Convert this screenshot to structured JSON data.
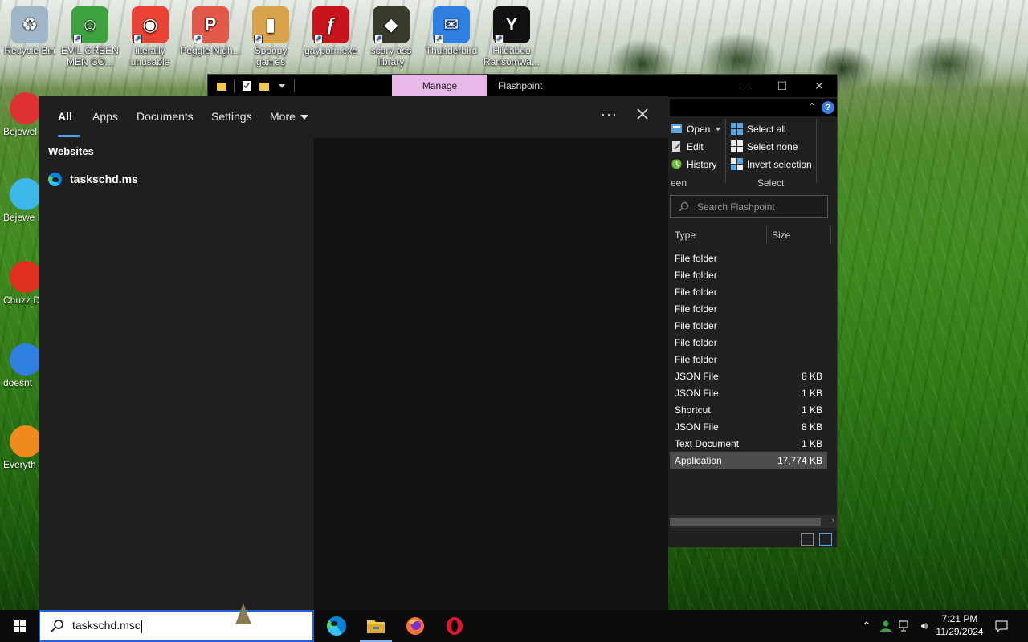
{
  "desktop": {
    "top_icons": [
      {
        "label": "Recycle Bin",
        "color": "#9fb6c8",
        "glyph": "♻"
      },
      {
        "label": "EVIL GREEN MEN CO...",
        "color": "#3ea33e",
        "glyph": "☺"
      },
      {
        "label": "literally unusable",
        "color": "#ea4335",
        "glyph": "◉"
      },
      {
        "label": "Peggle Nigh...",
        "color": "#e2584a",
        "glyph": "P"
      },
      {
        "label": "Spoopy games",
        "color": "#d8a24a",
        "glyph": "▮"
      },
      {
        "label": "gayporn.exe",
        "color": "#c8151b",
        "glyph": "ƒ"
      },
      {
        "label": "scary ass library",
        "color": "#3a3a2a",
        "glyph": "◆"
      },
      {
        "label": "Thunderbird",
        "color": "#2f7fe0",
        "glyph": "✉"
      },
      {
        "label": "Hildaboo Ransomwa...",
        "color": "#111111",
        "glyph": "Y"
      }
    ],
    "left_icons": [
      {
        "label": "Bejewel Delux",
        "color": "#d33"
      },
      {
        "label": "Bejewe Delux",
        "color": "#3bb7e8"
      },
      {
        "label": "Chuzz Delux",
        "color": "#e03020"
      },
      {
        "label": "doesnt",
        "color": "#2f7fe0"
      },
      {
        "label": "Everyth",
        "color": "#f08a1c"
      }
    ]
  },
  "explorer": {
    "manage_tab": "Manage",
    "title": "Flashpoint",
    "ribbon": {
      "open": "Open",
      "edit": "Edit",
      "history": "History",
      "open_group": "een",
      "select_all": "Select all",
      "select_none": "Select none",
      "invert_selection": "Invert selection",
      "select_group": "Select"
    },
    "search_placeholder": "Search Flashpoint",
    "columns": {
      "type": "Type",
      "size": "Size"
    },
    "rows": [
      {
        "type": "File folder",
        "size": ""
      },
      {
        "type": "File folder",
        "size": ""
      },
      {
        "type": "File folder",
        "size": ""
      },
      {
        "type": "File folder",
        "size": ""
      },
      {
        "type": "File folder",
        "size": ""
      },
      {
        "type": "File folder",
        "size": ""
      },
      {
        "type": "File folder",
        "size": ""
      },
      {
        "type": "JSON File",
        "size": "8 KB"
      },
      {
        "type": "JSON File",
        "size": "1 KB"
      },
      {
        "type": "Shortcut",
        "size": "1 KB"
      },
      {
        "type": "JSON File",
        "size": "8 KB"
      },
      {
        "type": "Text Document",
        "size": "1 KB"
      },
      {
        "type": "Application",
        "size": "17,774 KB"
      }
    ],
    "selected_row": 12
  },
  "search_panel": {
    "tabs": [
      "All",
      "Apps",
      "Documents",
      "Settings",
      "More"
    ],
    "active_tab": "All",
    "group_title": "Websites",
    "results": [
      {
        "label": "taskschd.ms",
        "icon": "edge-icon"
      }
    ]
  },
  "taskbar": {
    "search_value": "taskschd.msc",
    "apps": [
      "edge-icon",
      "file-explorer-icon",
      "firefox-icon",
      "opera-icon"
    ],
    "active_app": "file-explorer-icon",
    "time": "7:21 PM",
    "date": "11/29/2024"
  },
  "colors": {
    "accent": "#4ea1ff",
    "manage_tab": "#e8b8e8",
    "search_border": "#1f5fe0"
  }
}
